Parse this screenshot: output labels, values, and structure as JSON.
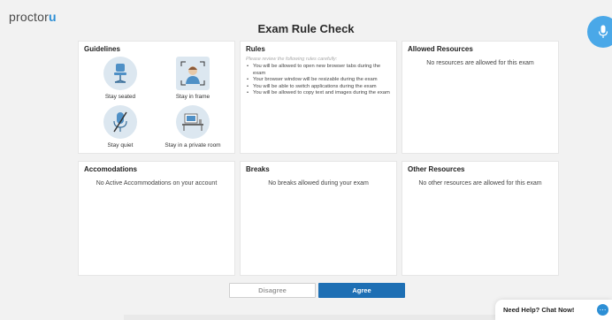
{
  "brand": {
    "name": "proctor",
    "accent": "u",
    "accent_color": "#2d8fd5"
  },
  "page": {
    "title": "Exam Rule Check"
  },
  "guidelines": {
    "title": "Guidelines",
    "items": [
      {
        "label": "Stay seated",
        "icon": "chair-icon"
      },
      {
        "label": "Stay in frame",
        "icon": "person-frame-icon"
      },
      {
        "label": "Stay quiet",
        "icon": "mute-mic-icon"
      },
      {
        "label": "Stay in a private room",
        "icon": "desk-room-icon"
      }
    ]
  },
  "rules": {
    "title": "Rules",
    "intro": "Please review the following rules carefully:",
    "items": [
      "You will be allowed to open new browser tabs during the exam",
      "Your browser window will be resizable during the exam",
      "You will be able to switch applications during the exam",
      "You will be allowed to copy text and images during the exam"
    ]
  },
  "allowed_resources": {
    "title": "Allowed Resources",
    "message": "No resources are allowed for this exam"
  },
  "accommodations": {
    "title": "Accomodations",
    "message": "No Active Accommodations on your account"
  },
  "breaks": {
    "title": "Breaks",
    "message": "No breaks allowed during your exam"
  },
  "other_resources": {
    "title": "Other Resources",
    "message": "No other resources are allowed for this exam"
  },
  "actions": {
    "disagree": "Disagree",
    "agree": "Agree"
  },
  "help": {
    "label": "Need Help? Chat Now!",
    "icon": "chat-bubble-icon"
  },
  "colors": {
    "primary": "#1e6fb4",
    "icon_bg": "#dce7f0",
    "mic_button": "#4aa8e8"
  }
}
